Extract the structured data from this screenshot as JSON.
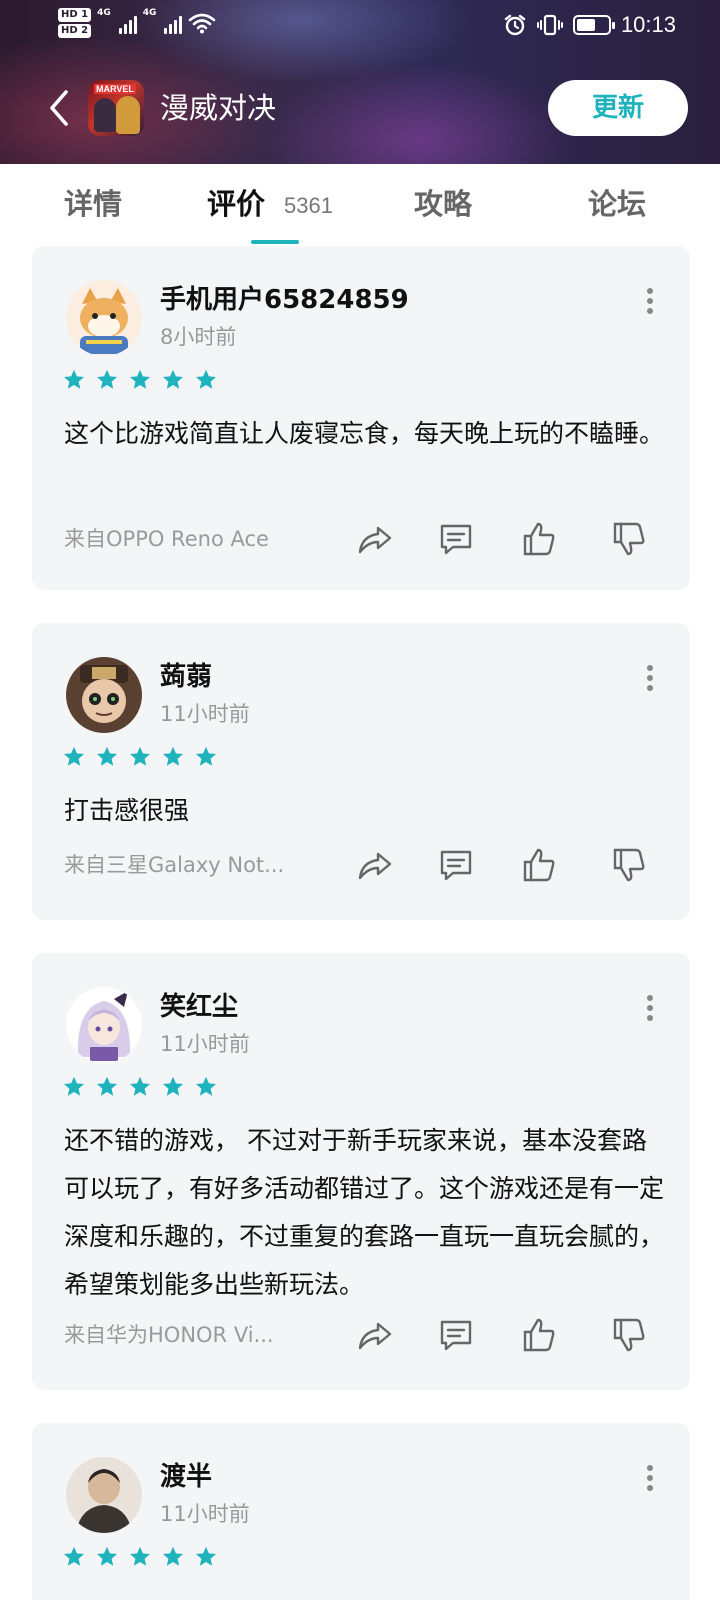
{
  "status_bar": {
    "hd1": "HD 1",
    "hd2": "HD 2",
    "net1": "4G",
    "net2": "4G",
    "time": "10:13",
    "battery_level": 0.6
  },
  "header": {
    "app_icon_brand": "MARVEL",
    "app_title": "漫威对决",
    "update_label": "更新"
  },
  "tabs": {
    "items": [
      {
        "label": "详情"
      },
      {
        "label": "评价"
      },
      {
        "label": "攻略"
      },
      {
        "label": "论坛"
      }
    ],
    "active_index": 1,
    "review_count": "5361"
  },
  "colors": {
    "accent": "#1fb3bd",
    "card_bg": "#f4f5f7",
    "star": "#1fb3bd"
  },
  "reviews": [
    {
      "username": "手机用户65824859",
      "time": "8小时前",
      "rating": 5,
      "text": "这个比游戏简直让人废寝忘食，每天晚上玩的不瞌睡。",
      "device": "来自OPPO Reno Ace"
    },
    {
      "username": "蒟蒻",
      "time": "11小时前",
      "rating": 5,
      "text": "打击感很强",
      "device": "来自三星Galaxy Not..."
    },
    {
      "username": "笑红尘",
      "time": "11小时前",
      "rating": 5,
      "text": "还不错的游戏， 不过对于新手玩家来说，基本没套路可以玩了，有好多活动都错过了。这个游戏还是有一定深度和乐趣的，不过重复的套路一直玩一直玩会腻的，希望策划能多出些新玩法。",
      "device": "来自华为HONOR Vi..."
    },
    {
      "username": "渡半",
      "time": "11小时前",
      "rating": 5,
      "text": "",
      "device": ""
    }
  ],
  "icons": {
    "back": "chevron-left-icon",
    "more": "more-vertical-icon",
    "share": "share-icon",
    "comment": "comment-icon",
    "like": "thumbs-up-icon",
    "dislike": "thumbs-down-icon",
    "star": "star-icon"
  }
}
